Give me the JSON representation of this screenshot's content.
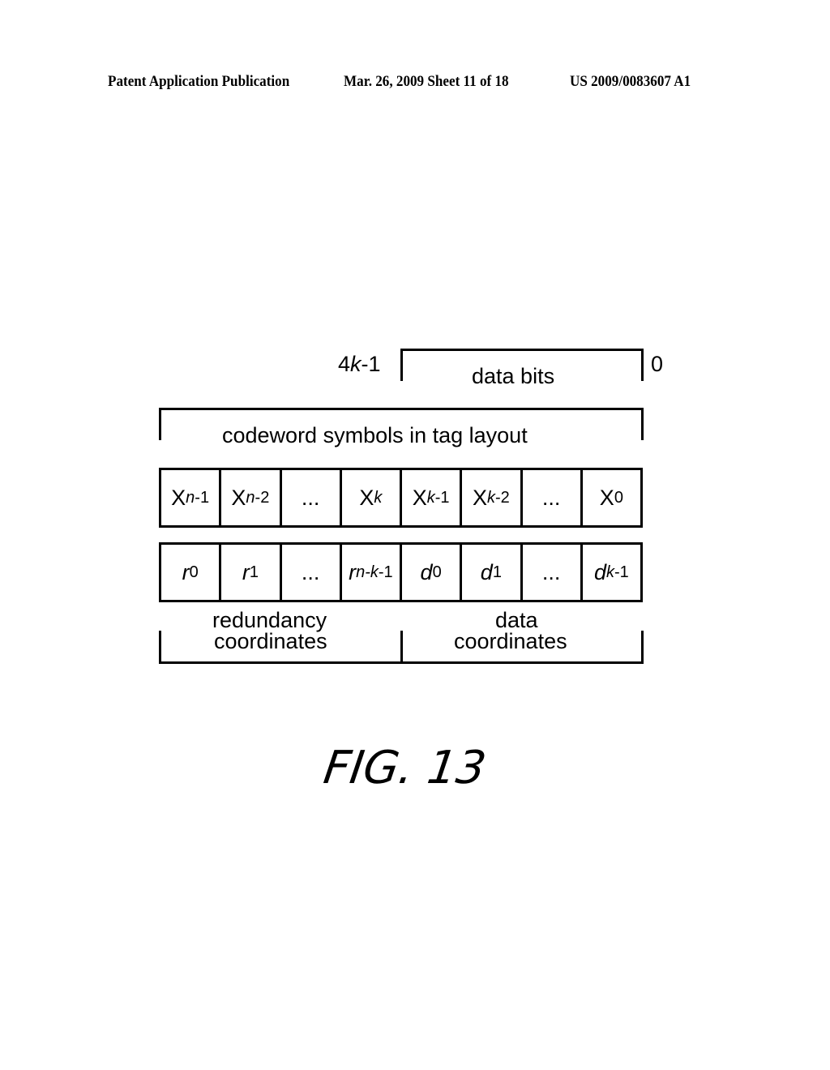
{
  "header": {
    "publication": "Patent Application Publication",
    "date_sheet": "Mar. 26, 2009  Sheet 11 of 18",
    "number": "US 2009/0083607 A1"
  },
  "diagram": {
    "data_bits": {
      "label": "data bits",
      "left_index": "4k-1",
      "left_index_num": "4",
      "left_index_var": "k",
      "left_index_suffix": "-1",
      "right_index": "0"
    },
    "codeword_label": "codeword symbols in tag layout",
    "codeword_row": [
      {
        "base": "X",
        "sub_var": "n",
        "sub_suffix": "-1"
      },
      {
        "base": "X",
        "sub_var": "n",
        "sub_suffix": "-2"
      },
      {
        "base": "...",
        "sub_var": "",
        "sub_suffix": ""
      },
      {
        "base": "X",
        "sub_var": "k",
        "sub_suffix": ""
      },
      {
        "base": "X",
        "sub_var": "k",
        "sub_suffix": "-1"
      },
      {
        "base": "X",
        "sub_var": "k",
        "sub_suffix": "-2"
      },
      {
        "base": "...",
        "sub_var": "",
        "sub_suffix": ""
      },
      {
        "base": "X",
        "sub_var": "",
        "sub_suffix": "0"
      }
    ],
    "coordinate_row": [
      {
        "base": "r",
        "sub_var": "",
        "sub_suffix": "0"
      },
      {
        "base": "r",
        "sub_var": "",
        "sub_suffix": "1"
      },
      {
        "base": "...",
        "sub_var": "",
        "sub_suffix": ""
      },
      {
        "base": "r",
        "sub_var": "n-k",
        "sub_suffix": "-1"
      },
      {
        "base": "d",
        "sub_var": "",
        "sub_suffix": "0"
      },
      {
        "base": "d",
        "sub_var": "",
        "sub_suffix": "1"
      },
      {
        "base": "...",
        "sub_var": "",
        "sub_suffix": ""
      },
      {
        "base": "d",
        "sub_var": "k",
        "sub_suffix": "-1"
      }
    ],
    "redundancy_label_1": "redundancy",
    "redundancy_label_2": "coordinates",
    "data_label_1": "data",
    "data_label_2": "coordinates"
  },
  "figure_label": "FIG. 13"
}
